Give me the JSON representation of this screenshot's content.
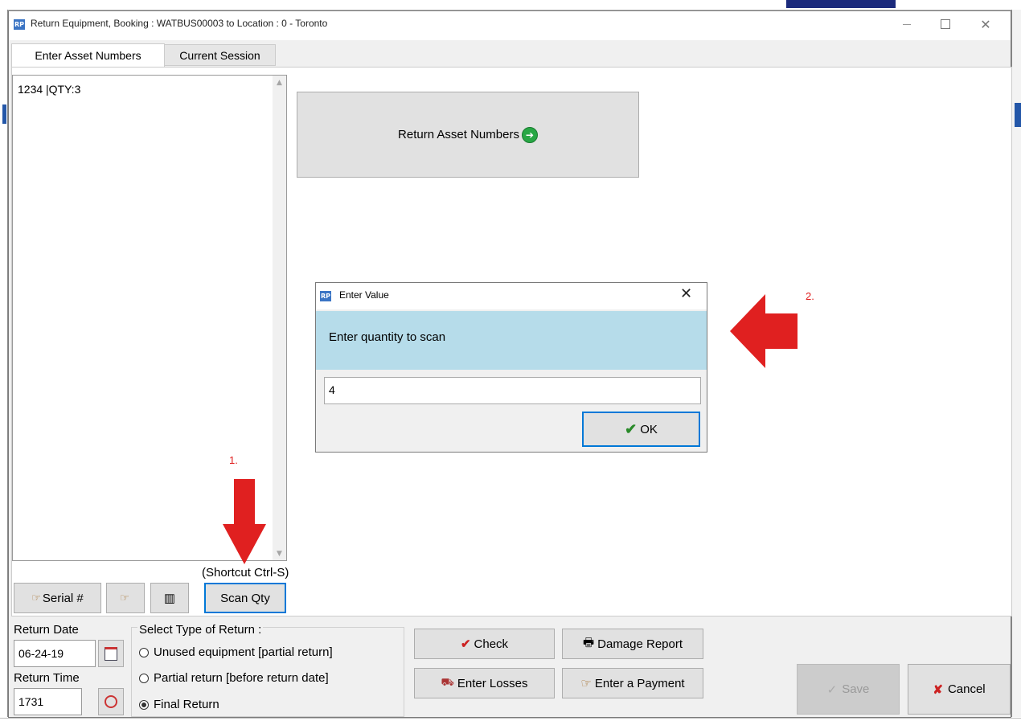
{
  "window": {
    "title": "Return Equipment, Booking : WATBUS00003 to Location : 0 - Toronto",
    "app_badge": "RP"
  },
  "tabs": [
    {
      "label": "Enter Asset Numbers",
      "active": true
    },
    {
      "label": "Current Session",
      "active": false
    }
  ],
  "asset_list": {
    "entries": [
      "1234 |QTY:3"
    ]
  },
  "return_asset_button": {
    "label": "Return Asset Numbers"
  },
  "dialog": {
    "title": "Enter Value",
    "prompt": "Enter quantity to scan",
    "input_value": "4",
    "ok_label": "OK"
  },
  "annotations": {
    "step1": "1.",
    "step2": "2."
  },
  "toolbar": {
    "serial_label": "Serial #",
    "shortcut_hint": "(Shortcut Ctrl-S)",
    "scan_qty_label": "Scan Qty"
  },
  "return_date": {
    "label": "Return Date",
    "value": "06-24-19"
  },
  "return_time": {
    "label": "Return Time",
    "value": "1731"
  },
  "return_type": {
    "title": "Select Type of Return :",
    "options": [
      {
        "label": "Unused equipment [partial return]",
        "selected": false
      },
      {
        "label": "Partial return [before return date]",
        "selected": false
      },
      {
        "label": "Final Return",
        "selected": true
      }
    ]
  },
  "actions": {
    "check_label": "Check",
    "damage_report_label": "Damage Report",
    "enter_losses_label": "Enter Losses",
    "enter_payment_label": "Enter a Payment",
    "save_label": "Save",
    "cancel_label": "Cancel"
  },
  "colors": {
    "annotation_red": "#e02020",
    "dialog_banner": "#b6dcea",
    "focus_blue": "#0078d7"
  }
}
